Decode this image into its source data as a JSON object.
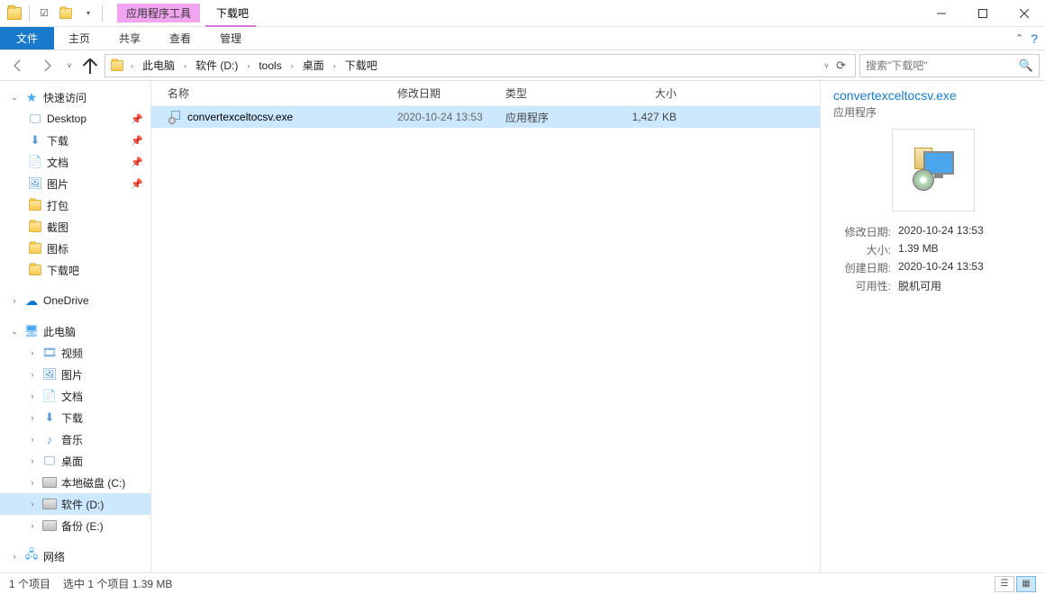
{
  "titlebar": {
    "contextual_label": "应用程序工具",
    "title": "下载吧"
  },
  "ribbon": {
    "file": "文件",
    "home": "主页",
    "share": "共享",
    "view": "查看",
    "manage": "管理"
  },
  "breadcrumb": {
    "segments": [
      "此电脑",
      "软件 (D:)",
      "tools",
      "桌面",
      "下载吧"
    ]
  },
  "search": {
    "placeholder": "搜索\"下载吧\""
  },
  "sidebar": {
    "quick_access": "快速访问",
    "quick_items": [
      {
        "label": "Desktop",
        "pin": true,
        "type": "desktop"
      },
      {
        "label": "下载",
        "pin": true,
        "type": "downloads"
      },
      {
        "label": "文档",
        "pin": true,
        "type": "documents"
      },
      {
        "label": "图片",
        "pin": true,
        "type": "pictures"
      },
      {
        "label": "打包",
        "pin": false,
        "type": "folder"
      },
      {
        "label": "截图",
        "pin": false,
        "type": "folder"
      },
      {
        "label": "图标",
        "pin": false,
        "type": "folder"
      },
      {
        "label": "下载吧",
        "pin": false,
        "type": "folder"
      }
    ],
    "onedrive": "OneDrive",
    "this_pc": "此电脑",
    "pc_items": [
      {
        "label": "视频",
        "type": "videos"
      },
      {
        "label": "图片",
        "type": "pictures"
      },
      {
        "label": "文档",
        "type": "documents"
      },
      {
        "label": "下载",
        "type": "downloads"
      },
      {
        "label": "音乐",
        "type": "music"
      },
      {
        "label": "桌面",
        "type": "desktop"
      },
      {
        "label": "本地磁盘 (C:)",
        "type": "drive"
      },
      {
        "label": "软件 (D:)",
        "type": "drive",
        "selected": true
      },
      {
        "label": "备份 (E:)",
        "type": "drive"
      }
    ],
    "network": "网络"
  },
  "columns": {
    "name": "名称",
    "date": "修改日期",
    "type": "类型",
    "size": "大小"
  },
  "files": [
    {
      "name": "convertexceltocsv.exe",
      "date": "2020-10-24 13:53",
      "type": "应用程序",
      "size": "1,427 KB",
      "selected": true
    }
  ],
  "details": {
    "title": "convertexceltocsv.exe",
    "type": "应用程序",
    "rows": [
      {
        "lbl": "修改日期:",
        "val": "2020-10-24 13:53"
      },
      {
        "lbl": "大小:",
        "val": "1.39 MB"
      },
      {
        "lbl": "创建日期:",
        "val": "2020-10-24 13:53"
      },
      {
        "lbl": "可用性:",
        "val": "脱机可用"
      }
    ]
  },
  "status": {
    "count": "1 个项目",
    "selected": "选中 1 个项目 1.39 MB"
  }
}
